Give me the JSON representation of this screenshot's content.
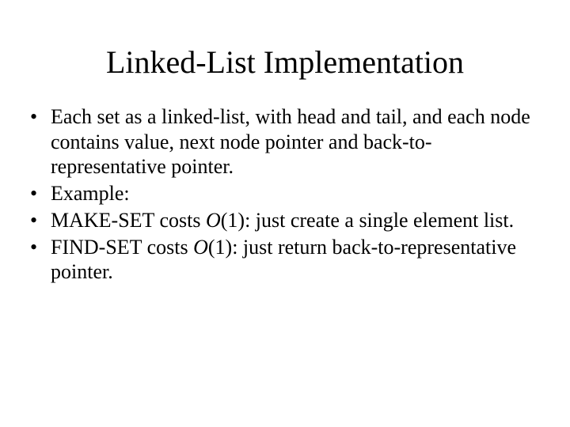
{
  "title": "Linked-List Implementation",
  "bullets": {
    "b1": "Each set as a linked-list, with head and tail, and each node contains value, next node pointer and back-to-representative pointer.",
    "b2": "Example:",
    "b3_pre": "MAKE-SET costs ",
    "b3_o": "O",
    "b3_post": "(1): just create a single element list.",
    "b4_pre": "FIND-SET costs ",
    "b4_o": "O",
    "b4_post": "(1): just return back-to-representative pointer."
  }
}
